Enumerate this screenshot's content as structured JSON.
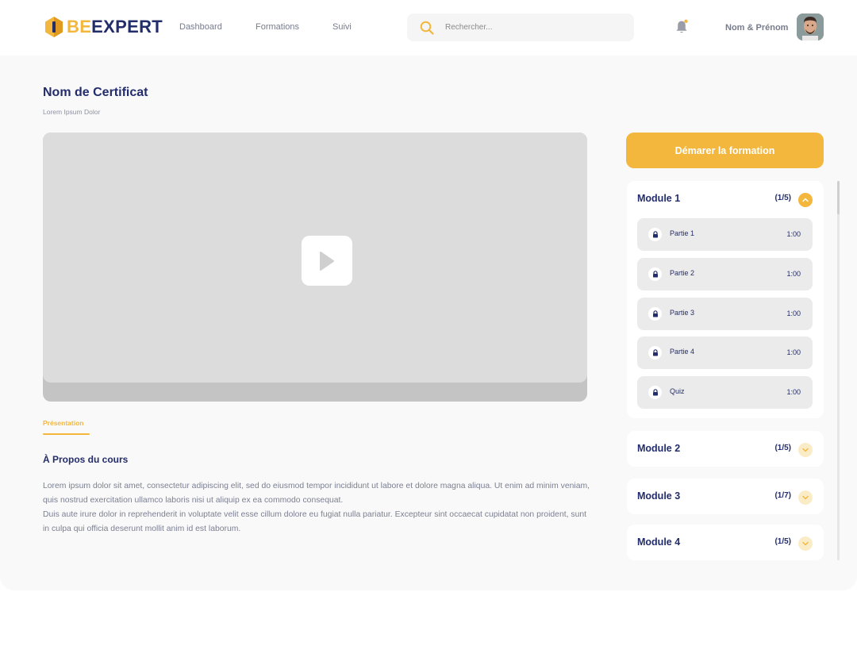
{
  "header": {
    "logo": {
      "part1": "BE",
      "part2": "EXPERT"
    },
    "nav": [
      {
        "label": "Dashboard"
      },
      {
        "label": "Formations"
      },
      {
        "label": "Suivi"
      }
    ],
    "search": {
      "placeholder": "Rechercher..."
    },
    "user": {
      "name": "Nom & Prénom"
    }
  },
  "course": {
    "title": "Nom de Certificat",
    "subtitle": "Lorem Ipsum Dolor"
  },
  "tabs": [
    {
      "label": "Présentation",
      "active": true
    }
  ],
  "about": {
    "title": "À Propos du cours",
    "paragraph1": "Lorem ipsum dolor sit amet, consectetur adipiscing elit, sed do eiusmod tempor incididunt ut labore et dolore magna aliqua. Ut enim ad minim veniam, quis nostrud exercitation ullamco laboris nisi ut aliquip ex ea commodo consequat.",
    "paragraph2": "Duis aute irure dolor in reprehenderit in voluptate velit esse cillum dolore eu fugiat nulla pariatur. Excepteur sint occaecat cupidatat non proident, sunt in culpa qui officia deserunt mollit anim id est laborum."
  },
  "start_button": {
    "label": "Démarer la formation"
  },
  "modules": [
    {
      "title": "Module 1",
      "count": "(1/5)",
      "expanded": true,
      "lessons": [
        {
          "label": "Partie 1",
          "duration": "1:00",
          "icon": "lock-icon"
        },
        {
          "label": "Partie 2",
          "duration": "1:00",
          "icon": "lock-icon"
        },
        {
          "label": "Partie 3",
          "duration": "1:00",
          "icon": "lock-icon"
        },
        {
          "label": "Partie 4",
          "duration": "1:00",
          "icon": "lock-icon"
        },
        {
          "label": "Quiz",
          "duration": "1:00",
          "icon": "lock-icon"
        }
      ]
    },
    {
      "title": "Module 2",
      "count": "(1/5)",
      "expanded": false
    },
    {
      "title": "Module 3",
      "count": "(1/7)",
      "expanded": false
    },
    {
      "title": "Module 4",
      "count": "(1/5)",
      "expanded": false
    }
  ],
  "colors": {
    "accent": "#f2b73c",
    "navy": "#232d6b",
    "background": "#f9f9f9"
  }
}
